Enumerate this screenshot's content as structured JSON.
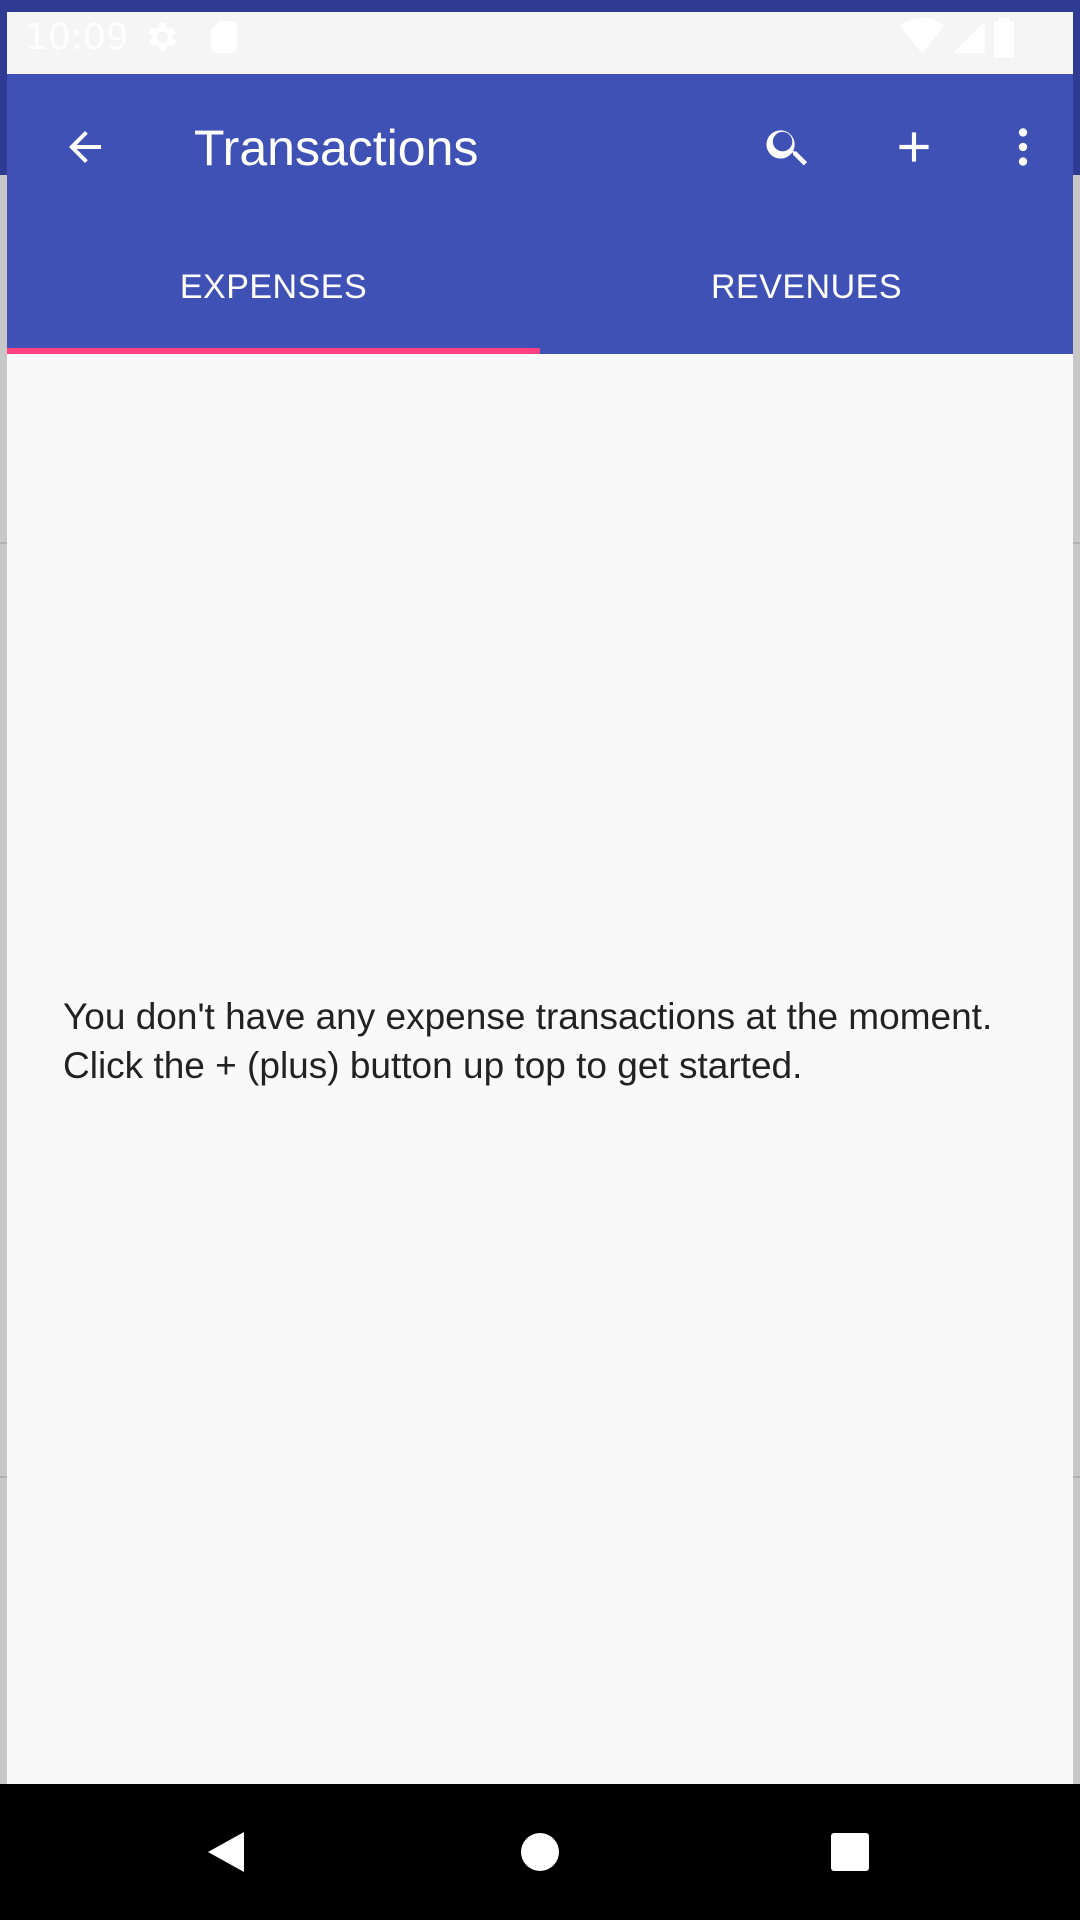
{
  "status_bar": {
    "time": "10:09",
    "icons": [
      "settings-icon",
      "sd-card-icon",
      "wifi-icon",
      "signal-icon",
      "battery-icon"
    ]
  },
  "app_bar": {
    "title": "Transactions",
    "back_icon": "back-arrow-icon",
    "actions": [
      "search-icon",
      "add-icon",
      "more-vert-icon"
    ]
  },
  "tabs": [
    {
      "label": "EXPENSES",
      "selected": true
    },
    {
      "label": "REVENUES",
      "selected": false
    }
  ],
  "empty_state": {
    "message": "You don't have any expense transactions at the moment. Click the + (plus) button up top to get started."
  },
  "nav_bar": {
    "buttons": [
      "back-triangle-icon",
      "home-circle-icon",
      "recents-square-icon"
    ]
  },
  "colors": {
    "primary": "#3f51b5",
    "accent": "#ff4081",
    "background": "#f9f9f9",
    "text": "#222222"
  }
}
